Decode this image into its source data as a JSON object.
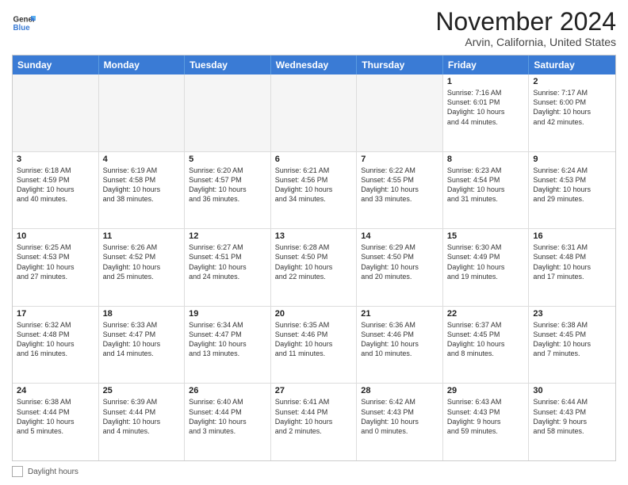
{
  "header": {
    "logo": {
      "general": "General",
      "blue": "Blue"
    },
    "title": "November 2024",
    "location": "Arvin, California, United States"
  },
  "weekdays": [
    "Sunday",
    "Monday",
    "Tuesday",
    "Wednesday",
    "Thursday",
    "Friday",
    "Saturday"
  ],
  "rows": [
    [
      {
        "empty": true
      },
      {
        "empty": true
      },
      {
        "empty": true
      },
      {
        "empty": true
      },
      {
        "empty": true
      },
      {
        "date": "1",
        "lines": [
          "Sunrise: 7:16 AM",
          "Sunset: 6:01 PM",
          "Daylight: 10 hours",
          "and 44 minutes."
        ]
      },
      {
        "date": "2",
        "lines": [
          "Sunrise: 7:17 AM",
          "Sunset: 6:00 PM",
          "Daylight: 10 hours",
          "and 42 minutes."
        ]
      }
    ],
    [
      {
        "date": "3",
        "lines": [
          "Sunrise: 6:18 AM",
          "Sunset: 4:59 PM",
          "Daylight: 10 hours",
          "and 40 minutes."
        ]
      },
      {
        "date": "4",
        "lines": [
          "Sunrise: 6:19 AM",
          "Sunset: 4:58 PM",
          "Daylight: 10 hours",
          "and 38 minutes."
        ]
      },
      {
        "date": "5",
        "lines": [
          "Sunrise: 6:20 AM",
          "Sunset: 4:57 PM",
          "Daylight: 10 hours",
          "and 36 minutes."
        ]
      },
      {
        "date": "6",
        "lines": [
          "Sunrise: 6:21 AM",
          "Sunset: 4:56 PM",
          "Daylight: 10 hours",
          "and 34 minutes."
        ]
      },
      {
        "date": "7",
        "lines": [
          "Sunrise: 6:22 AM",
          "Sunset: 4:55 PM",
          "Daylight: 10 hours",
          "and 33 minutes."
        ]
      },
      {
        "date": "8",
        "lines": [
          "Sunrise: 6:23 AM",
          "Sunset: 4:54 PM",
          "Daylight: 10 hours",
          "and 31 minutes."
        ]
      },
      {
        "date": "9",
        "lines": [
          "Sunrise: 6:24 AM",
          "Sunset: 4:53 PM",
          "Daylight: 10 hours",
          "and 29 minutes."
        ]
      }
    ],
    [
      {
        "date": "10",
        "lines": [
          "Sunrise: 6:25 AM",
          "Sunset: 4:53 PM",
          "Daylight: 10 hours",
          "and 27 minutes."
        ]
      },
      {
        "date": "11",
        "lines": [
          "Sunrise: 6:26 AM",
          "Sunset: 4:52 PM",
          "Daylight: 10 hours",
          "and 25 minutes."
        ]
      },
      {
        "date": "12",
        "lines": [
          "Sunrise: 6:27 AM",
          "Sunset: 4:51 PM",
          "Daylight: 10 hours",
          "and 24 minutes."
        ]
      },
      {
        "date": "13",
        "lines": [
          "Sunrise: 6:28 AM",
          "Sunset: 4:50 PM",
          "Daylight: 10 hours",
          "and 22 minutes."
        ]
      },
      {
        "date": "14",
        "lines": [
          "Sunrise: 6:29 AM",
          "Sunset: 4:50 PM",
          "Daylight: 10 hours",
          "and 20 minutes."
        ]
      },
      {
        "date": "15",
        "lines": [
          "Sunrise: 6:30 AM",
          "Sunset: 4:49 PM",
          "Daylight: 10 hours",
          "and 19 minutes."
        ]
      },
      {
        "date": "16",
        "lines": [
          "Sunrise: 6:31 AM",
          "Sunset: 4:48 PM",
          "Daylight: 10 hours",
          "and 17 minutes."
        ]
      }
    ],
    [
      {
        "date": "17",
        "lines": [
          "Sunrise: 6:32 AM",
          "Sunset: 4:48 PM",
          "Daylight: 10 hours",
          "and 16 minutes."
        ]
      },
      {
        "date": "18",
        "lines": [
          "Sunrise: 6:33 AM",
          "Sunset: 4:47 PM",
          "Daylight: 10 hours",
          "and 14 minutes."
        ]
      },
      {
        "date": "19",
        "lines": [
          "Sunrise: 6:34 AM",
          "Sunset: 4:47 PM",
          "Daylight: 10 hours",
          "and 13 minutes."
        ]
      },
      {
        "date": "20",
        "lines": [
          "Sunrise: 6:35 AM",
          "Sunset: 4:46 PM",
          "Daylight: 10 hours",
          "and 11 minutes."
        ]
      },
      {
        "date": "21",
        "lines": [
          "Sunrise: 6:36 AM",
          "Sunset: 4:46 PM",
          "Daylight: 10 hours",
          "and 10 minutes."
        ]
      },
      {
        "date": "22",
        "lines": [
          "Sunrise: 6:37 AM",
          "Sunset: 4:45 PM",
          "Daylight: 10 hours",
          "and 8 minutes."
        ]
      },
      {
        "date": "23",
        "lines": [
          "Sunrise: 6:38 AM",
          "Sunset: 4:45 PM",
          "Daylight: 10 hours",
          "and 7 minutes."
        ]
      }
    ],
    [
      {
        "date": "24",
        "lines": [
          "Sunrise: 6:38 AM",
          "Sunset: 4:44 PM",
          "Daylight: 10 hours",
          "and 5 minutes."
        ]
      },
      {
        "date": "25",
        "lines": [
          "Sunrise: 6:39 AM",
          "Sunset: 4:44 PM",
          "Daylight: 10 hours",
          "and 4 minutes."
        ]
      },
      {
        "date": "26",
        "lines": [
          "Sunrise: 6:40 AM",
          "Sunset: 4:44 PM",
          "Daylight: 10 hours",
          "and 3 minutes."
        ]
      },
      {
        "date": "27",
        "lines": [
          "Sunrise: 6:41 AM",
          "Sunset: 4:44 PM",
          "Daylight: 10 hours",
          "and 2 minutes."
        ]
      },
      {
        "date": "28",
        "lines": [
          "Sunrise: 6:42 AM",
          "Sunset: 4:43 PM",
          "Daylight: 10 hours",
          "and 0 minutes."
        ]
      },
      {
        "date": "29",
        "lines": [
          "Sunrise: 6:43 AM",
          "Sunset: 4:43 PM",
          "Daylight: 9 hours",
          "and 59 minutes."
        ]
      },
      {
        "date": "30",
        "lines": [
          "Sunrise: 6:44 AM",
          "Sunset: 4:43 PM",
          "Daylight: 9 hours",
          "and 58 minutes."
        ]
      }
    ]
  ],
  "footer": {
    "legend_label": "Daylight hours"
  }
}
